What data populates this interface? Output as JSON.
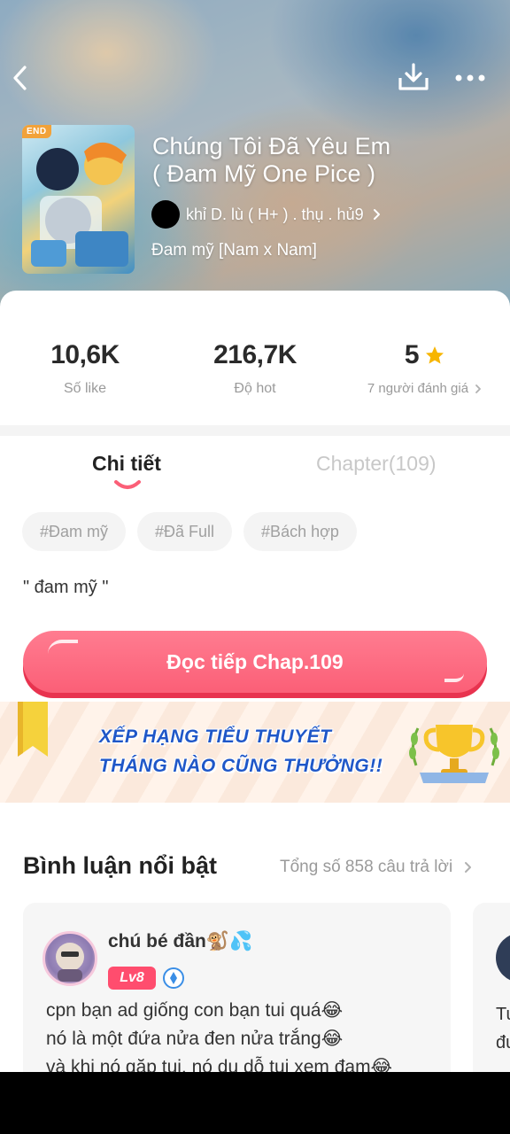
{
  "header": {
    "back_icon": "chevron-left-icon",
    "download_icon": "download-icon",
    "more_icon": "more-horizontal-icon"
  },
  "book": {
    "badge": "END",
    "title_line1": "Chúng Tôi Đã Yêu Em",
    "title_line2": "( Đam Mỹ One Pice )",
    "author": "khỉ D. lù ( H+ ) . thụ . hủ9",
    "genre": "Đam mỹ [Nam x Nam]"
  },
  "stats": {
    "likes_value": "10,6K",
    "likes_label": "Số like",
    "hot_value": "216,7K",
    "hot_label": "Độ hot",
    "rating_value": "5",
    "rating_label": "7 người đánh giá"
  },
  "tabs": {
    "detail": "Chi tiết",
    "chapter": "Chapter(109)"
  },
  "tags": [
    "#Đam mỹ",
    "#Đã Full",
    "#Bách hợp"
  ],
  "description": "\" đam mỹ \"",
  "read_button": "Đọc tiếp Chap.109",
  "banner": {
    "line1": "XẾP HẠNG TIỂU THUYẾT",
    "line2": "THÁNG NÀO CŨNG THƯỞNG!!"
  },
  "comments": {
    "heading": "Bình luận nổi bật",
    "total": "Tổng số 858 câu trả lời",
    "first": {
      "username": "chú bé đần🐒💦",
      "level": "Lv8",
      "line1": "cpn bạn ad giống con bạn tui quá😂",
      "line2": "nó là một đứa nửa đen nửa trắng😂",
      "line3": "và khi nó gặp tui, nó dụ dỗ tui xem đam😂"
    },
    "second": {
      "line1": "Tu",
      "line2": "đu"
    }
  },
  "colors": {
    "accent": "#fb5f77",
    "star": "#f7b500",
    "banner_text": "#1f57c8"
  }
}
